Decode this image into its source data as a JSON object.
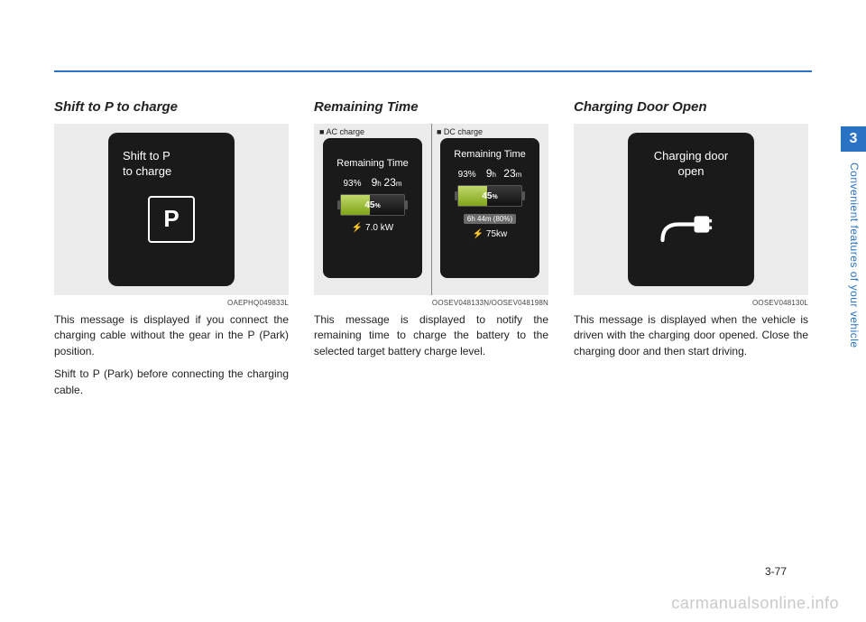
{
  "side": {
    "chapter_num": "3",
    "chapter_title": "Convenient features of your vehicle"
  },
  "page_number": "3-77",
  "watermark": "carmanualsonline.info",
  "columns": [
    {
      "title": "Shift to P to charge",
      "screen": {
        "line1": "Shift to P",
        "line2": "to charge",
        "p_label": "P"
      },
      "caption": "OAEPHQ049833L",
      "paras": [
        "This message is displayed if you connect the charging cable without the gear in the P (Park) position.",
        "Shift to P (Park) before connecting the charging cable."
      ]
    },
    {
      "title": "Remaining Time",
      "split_labels": {
        "left": "■ AC charge",
        "right": "■ DC charge"
      },
      "ac": {
        "title": "Remaining Time",
        "pct": "93%",
        "time_h": "9",
        "time_h_unit": "h",
        "time_m": "23",
        "time_m_unit": "m",
        "battery_pct": "45",
        "battery_pct_unit": "%",
        "power": "⚡ 7.0 kW"
      },
      "dc": {
        "title": "Remaining Time",
        "pct": "93%",
        "time_h": "9",
        "time_h_unit": "h",
        "time_m": "23",
        "time_m_unit": "m",
        "battery_pct": "45",
        "battery_pct_unit": "%",
        "target": "6h 44m (80%)",
        "power": "⚡ 75kw"
      },
      "caption": "OOSEV048133N/OOSEV048198N",
      "paras": [
        "This message is displayed to notify the remaining time to charge the battery to the selected target battery charge level."
      ]
    },
    {
      "title": "Charging Door Open",
      "screen": {
        "line1": "Charging door",
        "line2": "open"
      },
      "caption": "OOSEV048130L",
      "paras": [
        "This message is displayed when the vehicle is driven with the charging door opened. Close the charging door and then start driving."
      ]
    }
  ]
}
